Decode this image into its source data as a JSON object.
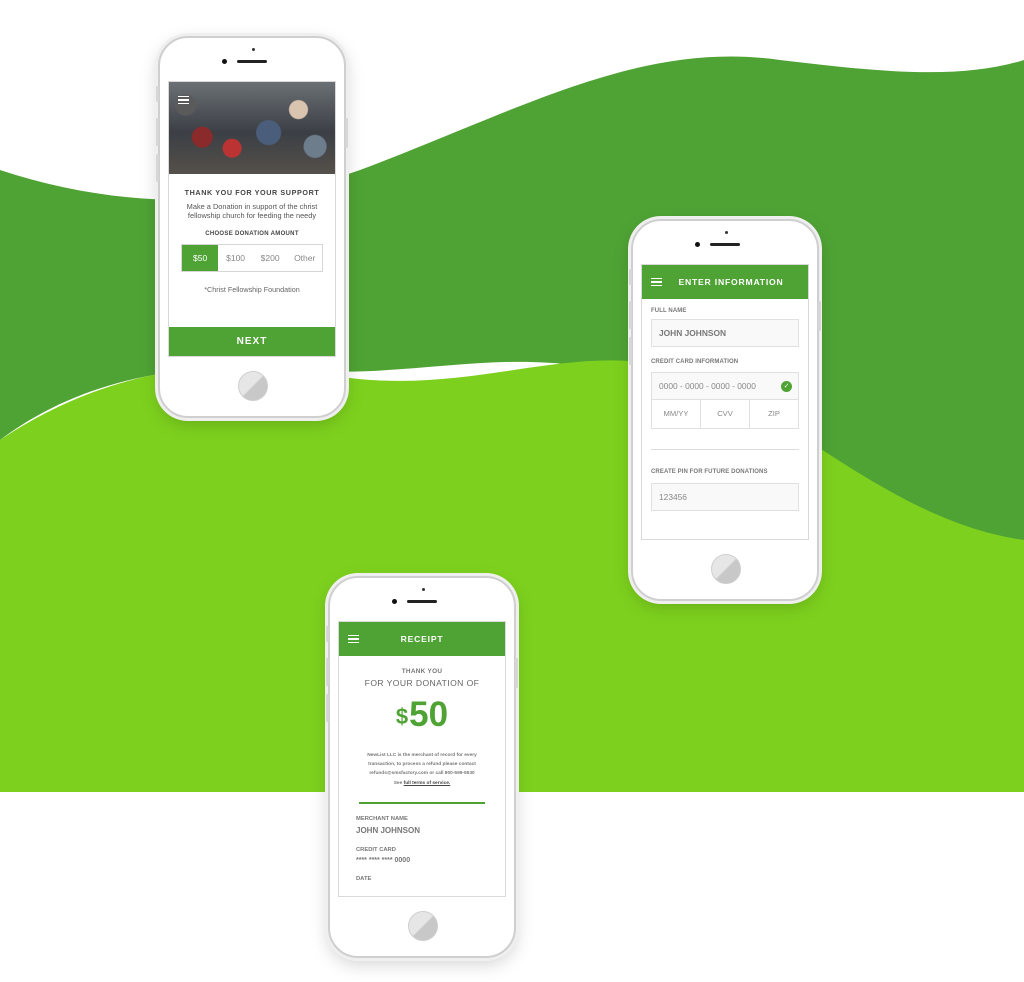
{
  "colors": {
    "dark_green": "#4fa334",
    "light_green": "#7dd11e",
    "accent": "#4fa334"
  },
  "phone1": {
    "heading": "THANK YOU FOR YOUR SUPPORT",
    "subtext": "Make a Donation in support of the christ fellowship church for feeding the needy",
    "choose_label": "CHOOSE DONATION AMOUNT",
    "amounts": [
      "$50",
      "$100",
      "$200",
      "Other"
    ],
    "selected_amount": "$50",
    "foundation_note": "*Christ Fellowship Foundation",
    "next_label": "NEXT",
    "menu_icon": "hamburger-icon"
  },
  "phone2": {
    "title": "ENTER INFORMATION",
    "full_name_label": "FULL NAME",
    "full_name_value": "JOHN JOHNSON",
    "card_label": "CREDIT CARD INFORMATION",
    "card_placeholder": "0000 - 0000 - 0000 - 0000",
    "exp_placeholder": "MM/YY",
    "cvv_placeholder": "CVV",
    "zip_placeholder": "ZIP",
    "pin_label": "CREATE PIN FOR FUTURE DONATIONS",
    "pin_value": "123456",
    "check_icon": "check-circle-icon"
  },
  "phone3": {
    "title": "RECEIPT",
    "thank_you": "THANK YOU",
    "for_donation": "FOR YOUR DONATION OF",
    "currency_symbol": "$",
    "amount": "50",
    "fine_print_1": "NewList LLC is the merchant of record for every transaction, to process a refund please contact refunds@smsfactory.com or call 800-599-5530",
    "fine_print_see": "See",
    "fine_print_link": "full terms of service.",
    "merchant_label": "MERCHANT NAME",
    "merchant_value": "JOHN JOHNSON",
    "card_label": "CREDIT CARD",
    "card_value": "**** **** **** 0000",
    "date_label": "DATE"
  }
}
